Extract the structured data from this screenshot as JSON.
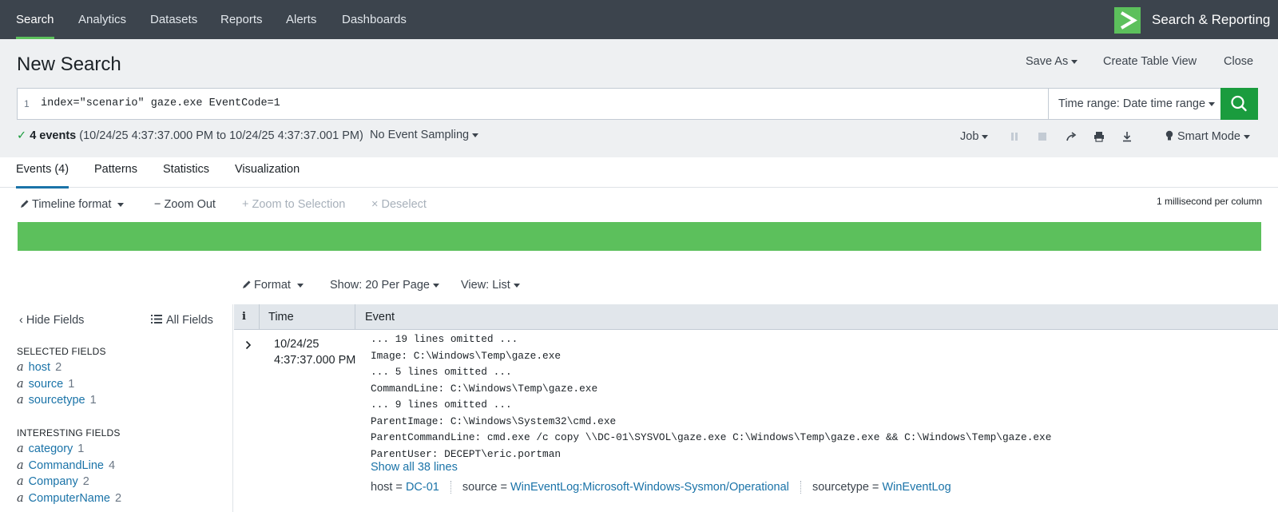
{
  "topnav": {
    "items": [
      "Search",
      "Analytics",
      "Datasets",
      "Reports",
      "Alerts",
      "Dashboards"
    ],
    "active": "Search",
    "app_title": "Search & Reporting",
    "logo_icon": "splunk-chevron-icon",
    "accent_color": "#5cc05c"
  },
  "header": {
    "title": "New Search",
    "save_as": "Save As",
    "create_table_view": "Create Table View",
    "close": "Close"
  },
  "search": {
    "line_number": "1",
    "query": "index=\"scenario\" gaze.exe EventCode=1",
    "time_range": "Time range: Date time range",
    "button_color": "#1a9c3e"
  },
  "status": {
    "event_count": "4 events",
    "time_span": "(10/24/25 4:37:37.000 PM to 10/24/25 4:37:37.001 PM)",
    "sampling": "No Event Sampling",
    "job": "Job",
    "mode": "Smart Mode"
  },
  "tabs": [
    "Events (4)",
    "Patterns",
    "Statistics",
    "Visualization"
  ],
  "timeline": {
    "format": "Timeline format",
    "zoom_out": "Zoom Out",
    "zoom_to_selection": "Zoom to Selection",
    "deselect": "Deselect",
    "scale": "1 millisecond per column"
  },
  "results_toolbar": {
    "format": "Format",
    "show": "Show: 20 Per Page",
    "view": "View: List"
  },
  "sidebar": {
    "hide_fields": "Hide Fields",
    "all_fields": "All Fields",
    "selected_title": "SELECTED FIELDS",
    "selected": [
      {
        "type": "a",
        "name": "host",
        "count": "2"
      },
      {
        "type": "a",
        "name": "source",
        "count": "1"
      },
      {
        "type": "a",
        "name": "sourcetype",
        "count": "1"
      }
    ],
    "interesting_title": "INTERESTING FIELDS",
    "interesting": [
      {
        "type": "a",
        "name": "category",
        "count": "1"
      },
      {
        "type": "a",
        "name": "CommandLine",
        "count": "4"
      },
      {
        "type": "a",
        "name": "Company",
        "count": "2"
      },
      {
        "type": "a",
        "name": "ComputerName",
        "count": "2"
      }
    ]
  },
  "table": {
    "col_info": "i",
    "col_time": "Time",
    "col_event": "Event",
    "row": {
      "date": "10/24/25",
      "time": "4:37:37.000 PM",
      "lines": [
        "... 19 lines omitted ...",
        "Image: C:\\Windows\\Temp\\gaze.exe",
        "... 5 lines omitted ...",
        "CommandLine: C:\\Windows\\Temp\\gaze.exe",
        "... 9 lines omitted ...",
        "ParentImage: C:\\Windows\\System32\\cmd.exe",
        "ParentCommandLine: cmd.exe /c copy \\\\DC-01\\SYSVOL\\gaze.exe C:\\Windows\\Temp\\gaze.exe && C:\\Windows\\Temp\\gaze.exe",
        "ParentUser: DECEPT\\eric.portman"
      ],
      "show_all": "Show all 38 lines",
      "meta": {
        "host_key": "host =",
        "host_val": "DC-01",
        "source_key": "source =",
        "source_val": "WinEventLog:Microsoft-Windows-Sysmon/Operational",
        "sourcetype_key": "sourcetype =",
        "sourcetype_val": "WinEventLog"
      }
    }
  }
}
